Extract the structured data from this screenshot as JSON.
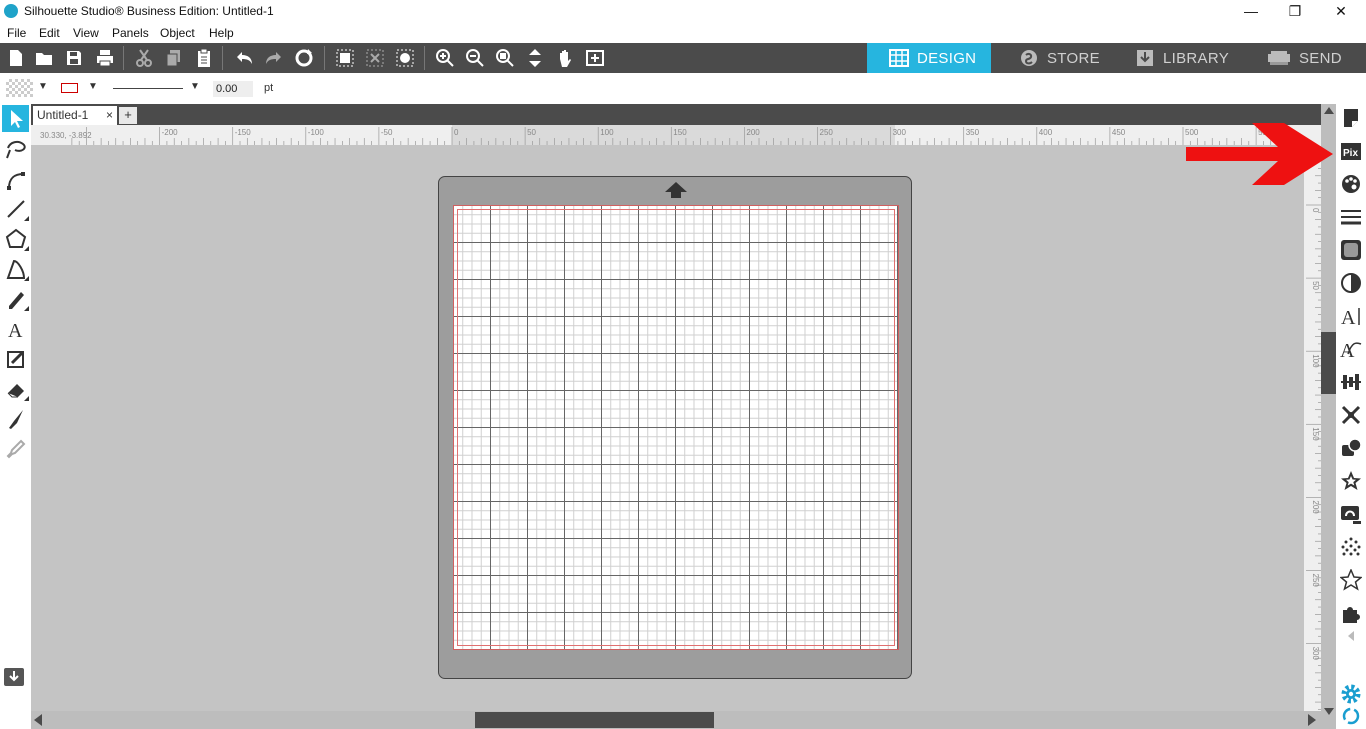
{
  "window": {
    "title": "Silhouette Studio® Business Edition: Untitled-1",
    "minimize": "—",
    "restore": "❐",
    "close": "✕"
  },
  "menu": [
    "File",
    "Edit",
    "View",
    "Panels",
    "Object",
    "Help"
  ],
  "nav_tabs": {
    "design": "DESIGN",
    "store": "STORE",
    "library": "LIBRARY",
    "send": "SEND"
  },
  "style_bar": {
    "line_width": "0.00",
    "unit": "pt"
  },
  "document": {
    "tab_label": "Untitled-1",
    "tab_close": "×",
    "new_tab": "+"
  },
  "ruler": {
    "cursor_coord": "30.330, -3.892",
    "h_ticks": [
      "-200",
      "-150",
      "-100",
      "-50",
      "0",
      "50",
      "100",
      "150",
      "200",
      "250",
      "300",
      "350",
      "400",
      "450",
      "500",
      "550"
    ],
    "v_ticks": [
      "0",
      "50",
      "100",
      "150",
      "200",
      "250",
      "300"
    ]
  },
  "colors": {
    "accent": "#26b5df",
    "toolbar": "#4b4b4b",
    "canvas": "#c4c4c4",
    "mat": "#9d9d9d",
    "annotation_arrow": "#ee1111"
  }
}
